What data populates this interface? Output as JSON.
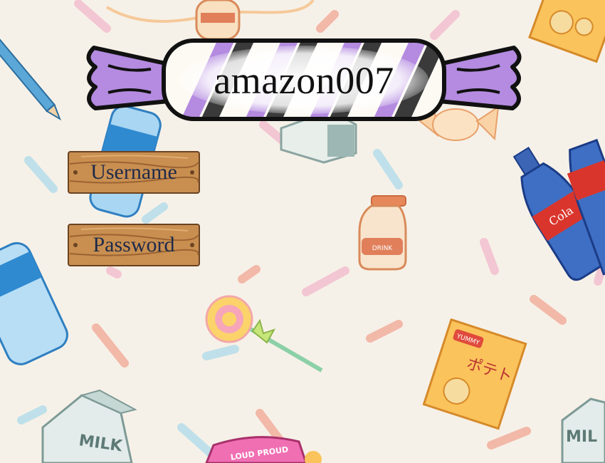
{
  "title": "amazon007",
  "fields": {
    "username_label": "Username",
    "password_label": "Password"
  },
  "background_decor": {
    "milk_carton_text": "MILK",
    "drink_bottle_text": "DRINK",
    "cola_text": "Cola",
    "chips_text": "YUMMY",
    "chips_sub": "ポテト",
    "candy_pack_text": "LOUD PROUD"
  },
  "colors": {
    "background": "#f6f1e8",
    "candy_purple": "#b48be0",
    "wood": "#c98f50",
    "label_text": "#1e2a4a"
  }
}
